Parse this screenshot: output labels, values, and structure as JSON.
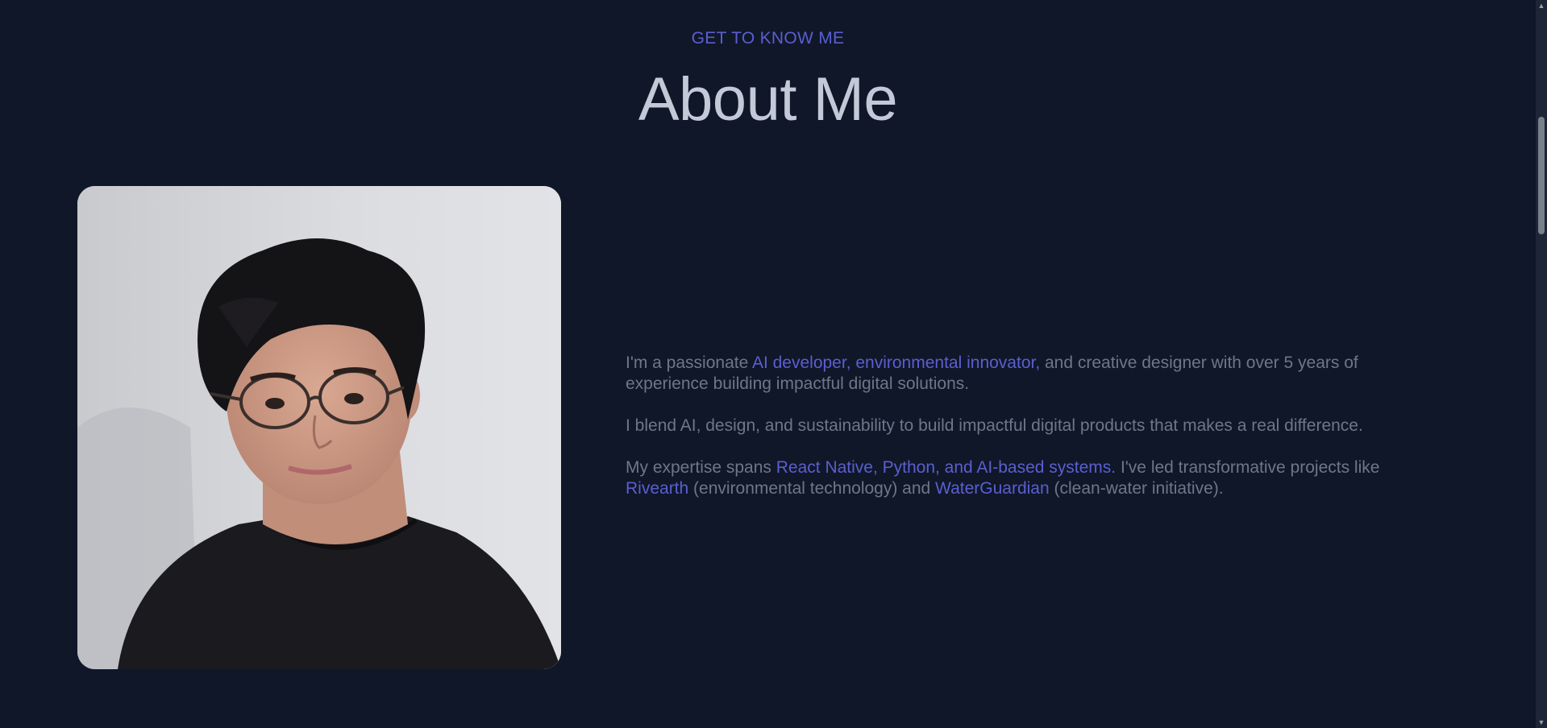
{
  "section": {
    "eyebrow": "GET TO KNOW ME",
    "title": "About Me"
  },
  "photo": {
    "icon": "portrait-photo"
  },
  "bio": {
    "p1": {
      "before": "I'm a passionate ",
      "highlight": "AI developer, environmental innovator,",
      "after": " and creative designer with over 5 years of experience building impactful digital solutions."
    },
    "p2": {
      "text": "I blend AI, design, and sustainability to build impactful digital products that makes a real difference."
    },
    "p3": {
      "before": "My expertise spans ",
      "highlight": "React Native, Python, and AI-based systems.",
      "middle": " I've led transformative projects like ",
      "project1": "Rivearth",
      "project1_desc": " (environmental technology) and ",
      "project2": "WaterGuardian",
      "project2_desc": " (clean-water initiative)."
    }
  },
  "colors": {
    "background": "#101729",
    "accent": "#5a5fcf",
    "title": "#c3c9d6",
    "body_text": "#6e7687"
  },
  "scrollbar": {
    "up_icon": "arrow-up-icon",
    "down_icon": "arrow-down-icon"
  }
}
